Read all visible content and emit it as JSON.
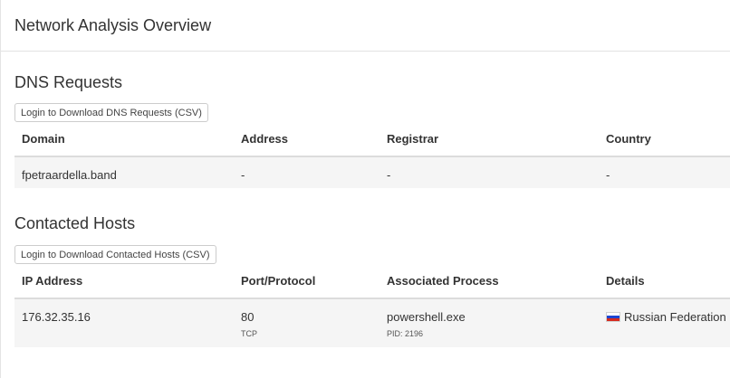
{
  "header": {
    "title": "Network Analysis Overview"
  },
  "dns": {
    "title": "DNS Requests",
    "download_label": "Login to Download DNS Requests (CSV)",
    "columns": [
      "Domain",
      "Address",
      "Registrar",
      "Country"
    ],
    "rows": [
      {
        "domain": "fpetraardella.band",
        "address": "-",
        "registrar": "-",
        "country": "-"
      }
    ]
  },
  "hosts": {
    "title": "Contacted Hosts",
    "download_label": "Login to Download Contacted Hosts (CSV)",
    "columns": [
      "IP Address",
      "Port/Protocol",
      "Associated Process",
      "Details"
    ],
    "rows": [
      {
        "ip": "176.32.35.16",
        "port": "80",
        "protocol": "TCP",
        "process": "powershell.exe",
        "pid": "PID: 2196",
        "country_flag": "russia-flag-icon",
        "country": "Russian Federation"
      }
    ]
  },
  "colors": {
    "row_background": "#f5f5f5",
    "border": "#dcdcdc",
    "text": "#333333"
  }
}
